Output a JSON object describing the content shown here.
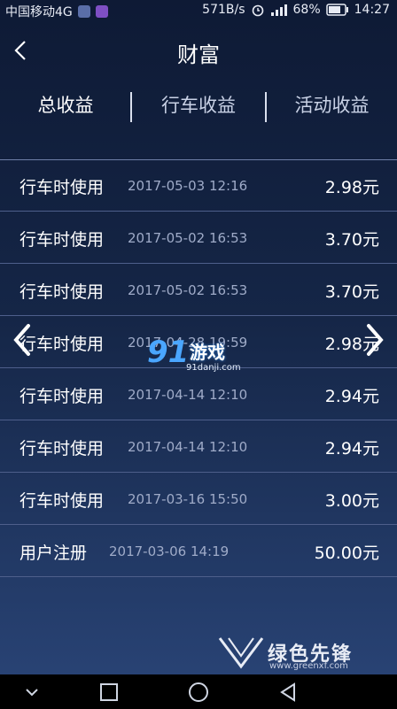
{
  "status_bar": {
    "carrier": "中国移动4G",
    "speed": "571B/s",
    "battery": "68%",
    "time": "14:27"
  },
  "header": {
    "title": "财富"
  },
  "tabs": [
    {
      "label": "总收益",
      "active": true
    },
    {
      "label": "行车收益",
      "active": false
    },
    {
      "label": "活动收益",
      "active": false
    }
  ],
  "records": [
    {
      "type": "行车时使用",
      "date": "2017-05-03 12:16",
      "amount": "2.98元"
    },
    {
      "type": "行车时使用",
      "date": "2017-05-02 16:53",
      "amount": "3.70元"
    },
    {
      "type": "行车时使用",
      "date": "2017-05-02 16:53",
      "amount": "3.70元"
    },
    {
      "type": "行车时使用",
      "date": "2017-04-28 19:59",
      "amount": "2.98元"
    },
    {
      "type": "行车时使用",
      "date": "2017-04-14 12:10",
      "amount": "2.94元"
    },
    {
      "type": "行车时使用",
      "date": "2017-04-14 12:10",
      "amount": "2.94元"
    },
    {
      "type": "行车时使用",
      "date": "2017-03-16 15:50",
      "amount": "3.00元"
    },
    {
      "type": "用户注册",
      "date": "2017-03-06 14:19",
      "amount": "50.00元"
    }
  ],
  "watermark": {
    "logo": "91",
    "text": "游戏",
    "url": "91danji.com"
  },
  "brand": {
    "text": "绿色先锋",
    "url": "www.greenxf.com"
  },
  "icons": {
    "back": "back-arrow-icon",
    "prev": "chevron-left-icon",
    "next": "chevron-right-icon"
  }
}
